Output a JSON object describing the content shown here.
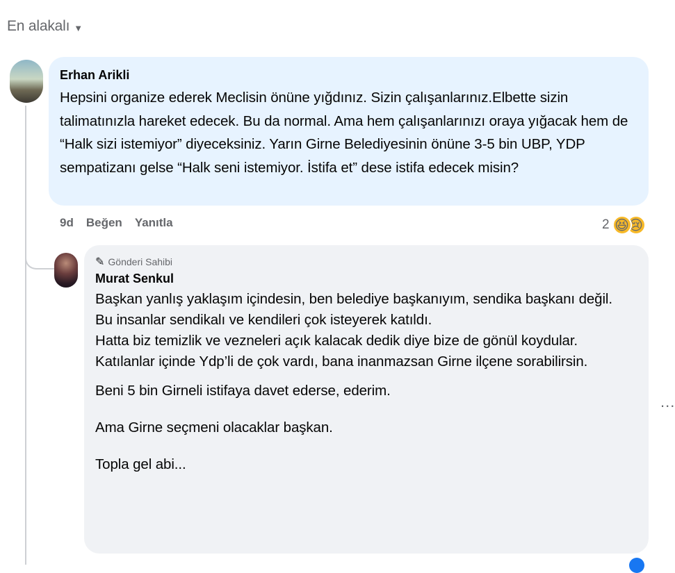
{
  "sort": {
    "label": "En alakalı",
    "icon": "caret-down-icon"
  },
  "comment": {
    "author": "Erhan Arikli",
    "text": "Hepsini organize ederek Meclisin önüne yığdınız. Sizin çalışanlarınız.Elbette sizin talimatınızla hareket edecek. Bu da normal. Ama hem çalışanlarınızı oraya yığacak hem de “Halk sizi istemiyor” diyeceksiniz. Yarın Girne Belediyesinin önüne 3-5 bin UBP, YDP sempatizanı gelse “Halk seni istemiyor. İstifa et” dese istifa edecek misin?",
    "time": "9d",
    "like_label": "Beğen",
    "reply_label": "Yanıtla",
    "reaction_count": "2",
    "reactions": [
      "laugh-emoji",
      "sad-emoji"
    ]
  },
  "reply": {
    "badge": "Gönderi Sahibi",
    "badge_icon": "pencil-icon",
    "author": "Murat Senkul",
    "paragraphs": [
      "Başkan yanlış yaklaşım içindesin, ben belediye başkanıyım, sendika başkanı değil.",
      "Bu insanlar sendikalı ve kendileri çok isteyerek katıldı.",
      "Hatta biz temizlik ve vezneleri açık kalacak dedik diye bize de gönül koydular.",
      "Katılanlar içinde Ydp’li de çok vardı, bana inanmazsan Girne ilçene sorabilirsin.",
      "Beni 5 bin Girneli istifaya davet ederse, ederim.",
      "Ama Girne seçmeni olacaklar başkan.",
      "Topla gel abi..."
    ],
    "more_label": "..."
  },
  "colors": {
    "comment_bg": "#e7f3ff",
    "reply_bg": "#f0f2f5",
    "meta": "#65676b",
    "accent": "#1877f2"
  }
}
